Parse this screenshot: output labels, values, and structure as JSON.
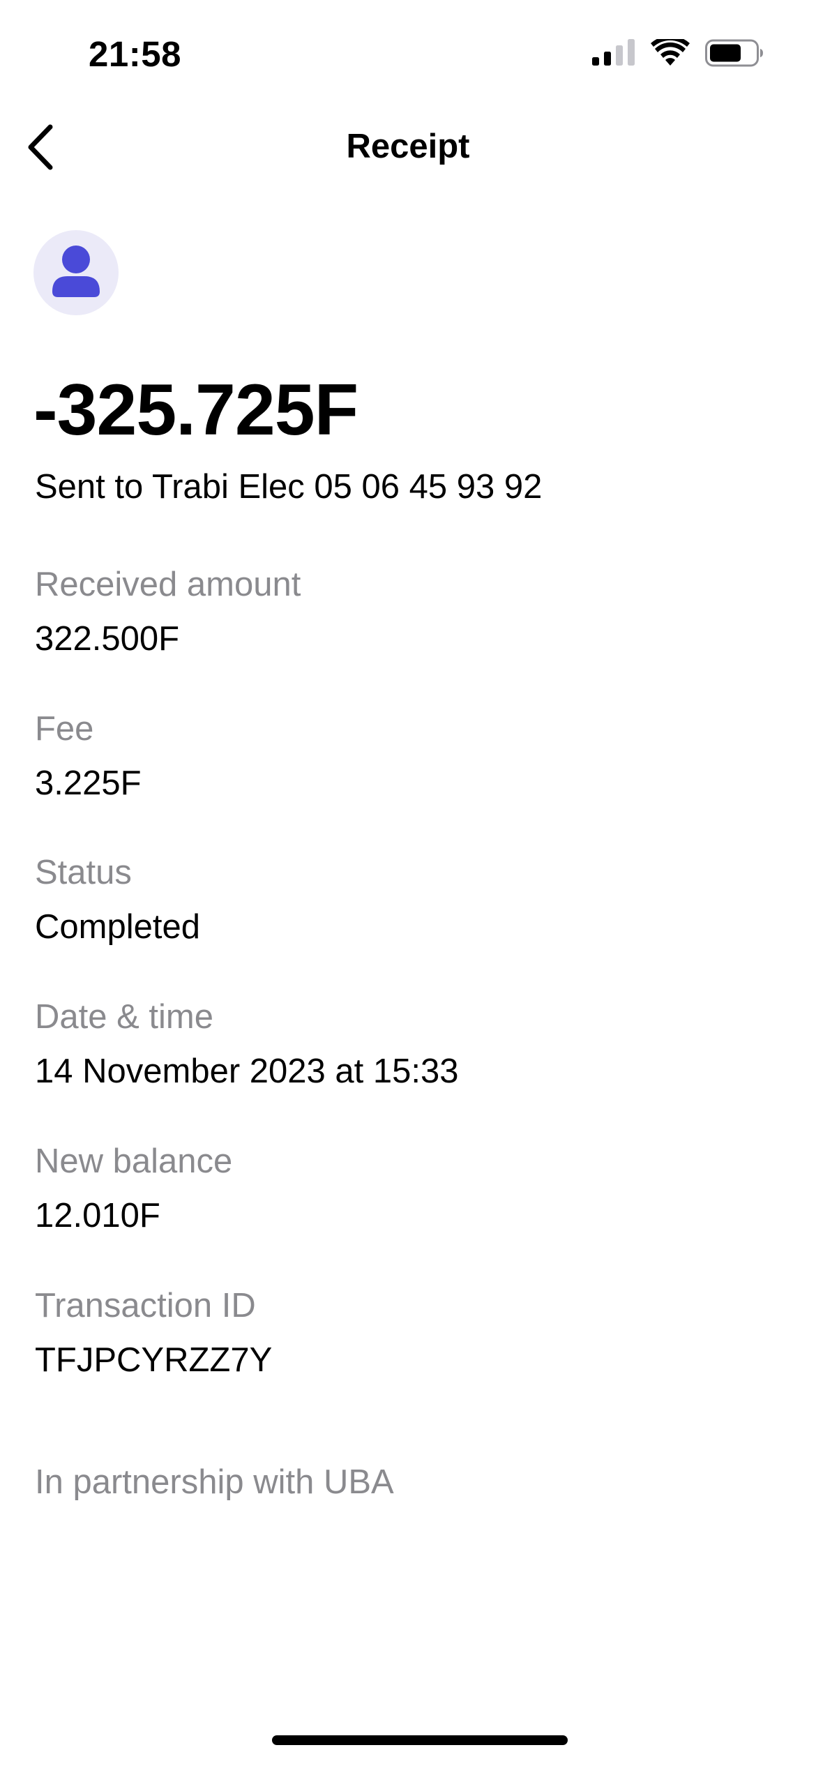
{
  "status_bar": {
    "time": "21:58",
    "icons": [
      "cellular-signal-icon",
      "wifi-icon",
      "battery-icon"
    ]
  },
  "nav": {
    "back_icon": "chevron-left-icon",
    "title": "Receipt"
  },
  "avatar": {
    "icon": "person-icon",
    "bg_color": "#ebeaf8",
    "icon_color": "#4a4ad8"
  },
  "transaction": {
    "amount": "-325.725F",
    "recipient": "Sent to Trabi Elec 05 06 45 93 92"
  },
  "details": [
    {
      "label": "Received amount",
      "value": "322.500F"
    },
    {
      "label": "Fee",
      "value": "3.225F"
    },
    {
      "label": "Status",
      "value": "Completed"
    },
    {
      "label": "Date & time",
      "value": "14 November 2023 at 15:33"
    },
    {
      "label": "New balance",
      "value": "12.010F"
    },
    {
      "label": "Transaction ID",
      "value": "TFJPCYRZZ7Y"
    }
  ],
  "footer": {
    "partnership": "In partnership with UBA"
  }
}
